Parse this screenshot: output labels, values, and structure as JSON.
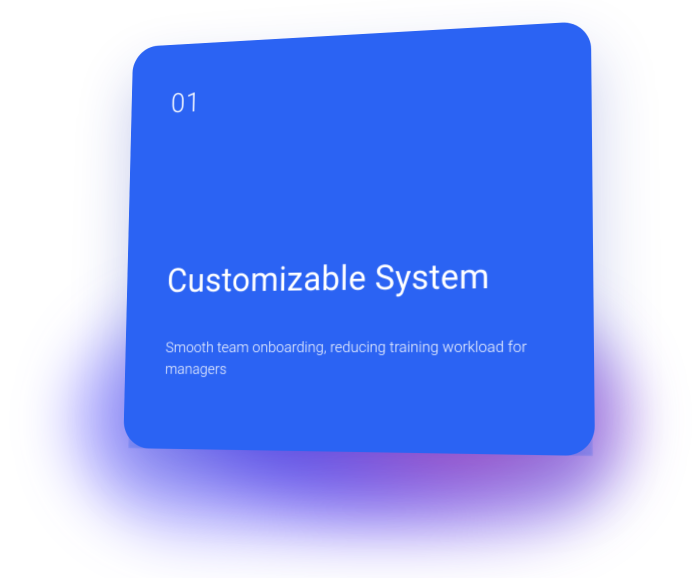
{
  "card": {
    "number": "01",
    "title": "Customizable System",
    "description": "Smooth team onboarding, reducing training workload for managers"
  },
  "colors": {
    "card_bg": "#2b63f3",
    "glow_magenta": "#d228aa",
    "glow_violet": "#5a28ff"
  }
}
